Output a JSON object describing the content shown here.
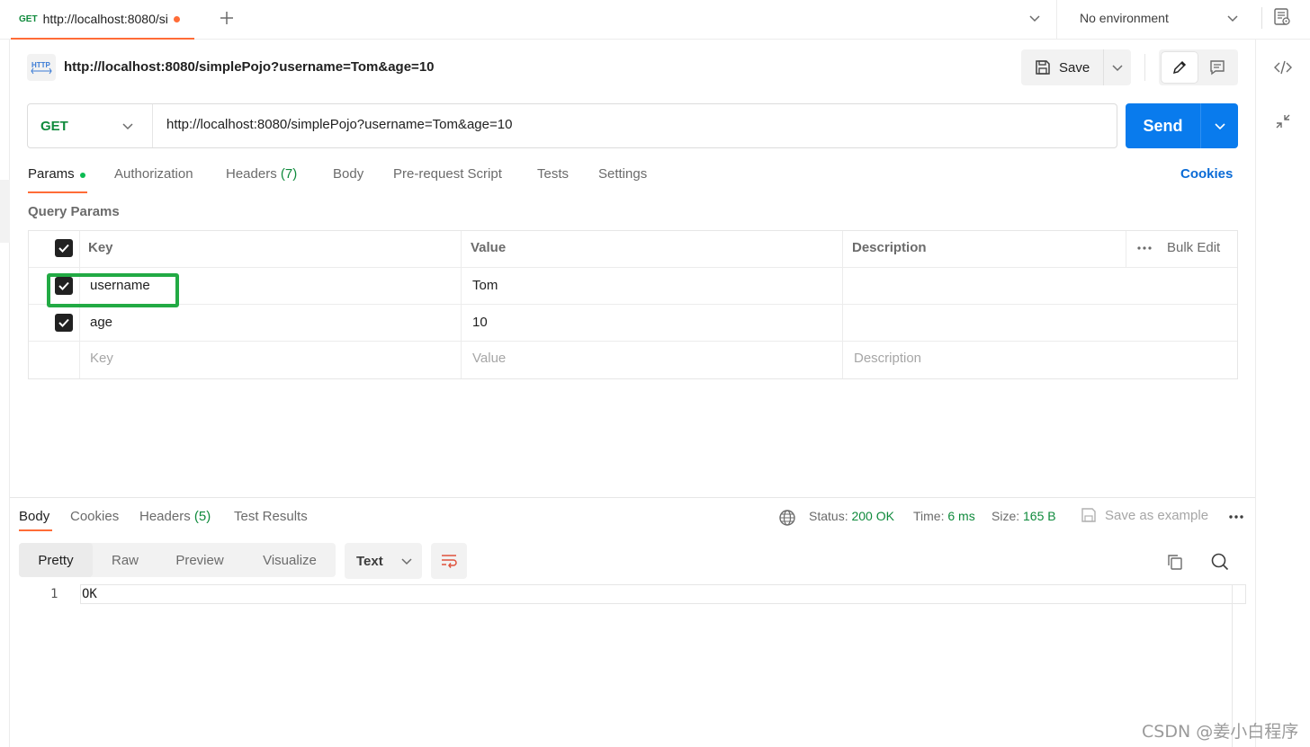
{
  "tabbar": {
    "active_tab": {
      "method": "GET",
      "title": "http://localhost:8080/si"
    },
    "environment": "No environment"
  },
  "request": {
    "icon_label": "HTTP",
    "title": "http://localhost:8080/simplePojo?username=Tom&age=10",
    "save_label": "Save",
    "method": "GET",
    "url": "http://localhost:8080/simplePojo?username=Tom&age=10",
    "send_label": "Send"
  },
  "request_tabs": {
    "params": "Params",
    "authorization": "Authorization",
    "headers": "Headers",
    "headers_count": "(7)",
    "body": "Body",
    "pre_request": "Pre-request Script",
    "tests": "Tests",
    "settings": "Settings",
    "cookies": "Cookies"
  },
  "query_params": {
    "label": "Query Params",
    "headers": {
      "key": "Key",
      "value": "Value",
      "description": "Description",
      "bulk_edit": "Bulk Edit"
    },
    "rows": [
      {
        "key": "username",
        "value": "Tom",
        "checked": true
      },
      {
        "key": "age",
        "value": "10",
        "checked": true
      }
    ],
    "placeholder": {
      "key": "Key",
      "value": "Value",
      "description": "Description"
    }
  },
  "response": {
    "tabs": {
      "body": "Body",
      "cookies": "Cookies",
      "headers": "Headers",
      "headers_count": "(5)",
      "test_results": "Test Results"
    },
    "status_label": "Status:",
    "status_value": "200 OK",
    "time_label": "Time:",
    "time_value": "6 ms",
    "size_label": "Size:",
    "size_value": "165 B",
    "save_example": "Save as example",
    "views": {
      "pretty": "Pretty",
      "raw": "Raw",
      "preview": "Preview",
      "visualize": "Visualize"
    },
    "format": "Text",
    "line_number": "1",
    "body_text": "OK"
  },
  "watermark": "CSDN @姜小白程序",
  "colors": {
    "accent": "#ff6c37",
    "send": "#097bed",
    "get": "#0f8a3c",
    "highlight": "#22aa44"
  }
}
